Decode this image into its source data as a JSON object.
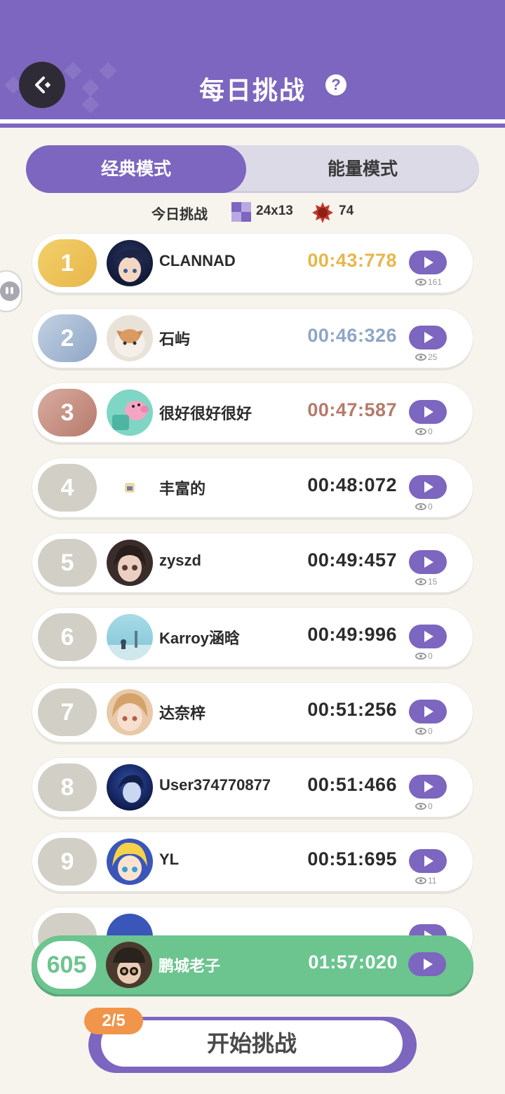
{
  "header": {
    "title": "每日挑战",
    "help": "?"
  },
  "tabs": [
    {
      "label": "经典模式"
    },
    {
      "label": "能量模式"
    }
  ],
  "info": {
    "label": "今日挑战",
    "size": "24x13",
    "mines": "74"
  },
  "colors": {
    "accent": "#7c66bf",
    "gold": "#e8b64a",
    "silver": "#8ea6c6",
    "bronze": "#b67a6a",
    "green": "#6cc48f",
    "orange": "#f0954a"
  },
  "rows": [
    {
      "rank": "1",
      "name": "CLANNAD",
      "time": "00:43:778",
      "views": "161"
    },
    {
      "rank": "2",
      "name": "石屿",
      "time": "00:46:326",
      "views": "25"
    },
    {
      "rank": "3",
      "name": "很好很好很好",
      "time": "00:47:587",
      "views": "0"
    },
    {
      "rank": "4",
      "name": "丰富的",
      "time": "00:48:072",
      "views": "0"
    },
    {
      "rank": "5",
      "name": "zyszd",
      "time": "00:49:457",
      "views": "15"
    },
    {
      "rank": "6",
      "name": "Karroy涵晗",
      "time": "00:49:996",
      "views": "0"
    },
    {
      "rank": "7",
      "name": "达奈梓",
      "time": "00:51:256",
      "views": "0"
    },
    {
      "rank": "8",
      "name": "User374770877",
      "time": "00:51:466",
      "views": "0"
    },
    {
      "rank": "9",
      "name": "YL",
      "time": "00:51:695",
      "views": "11"
    }
  ],
  "my_row": {
    "rank": "605",
    "name": "鹏城老子",
    "time": "01:57:020"
  },
  "start": {
    "label": "开始挑战",
    "attempts": "2/5"
  }
}
